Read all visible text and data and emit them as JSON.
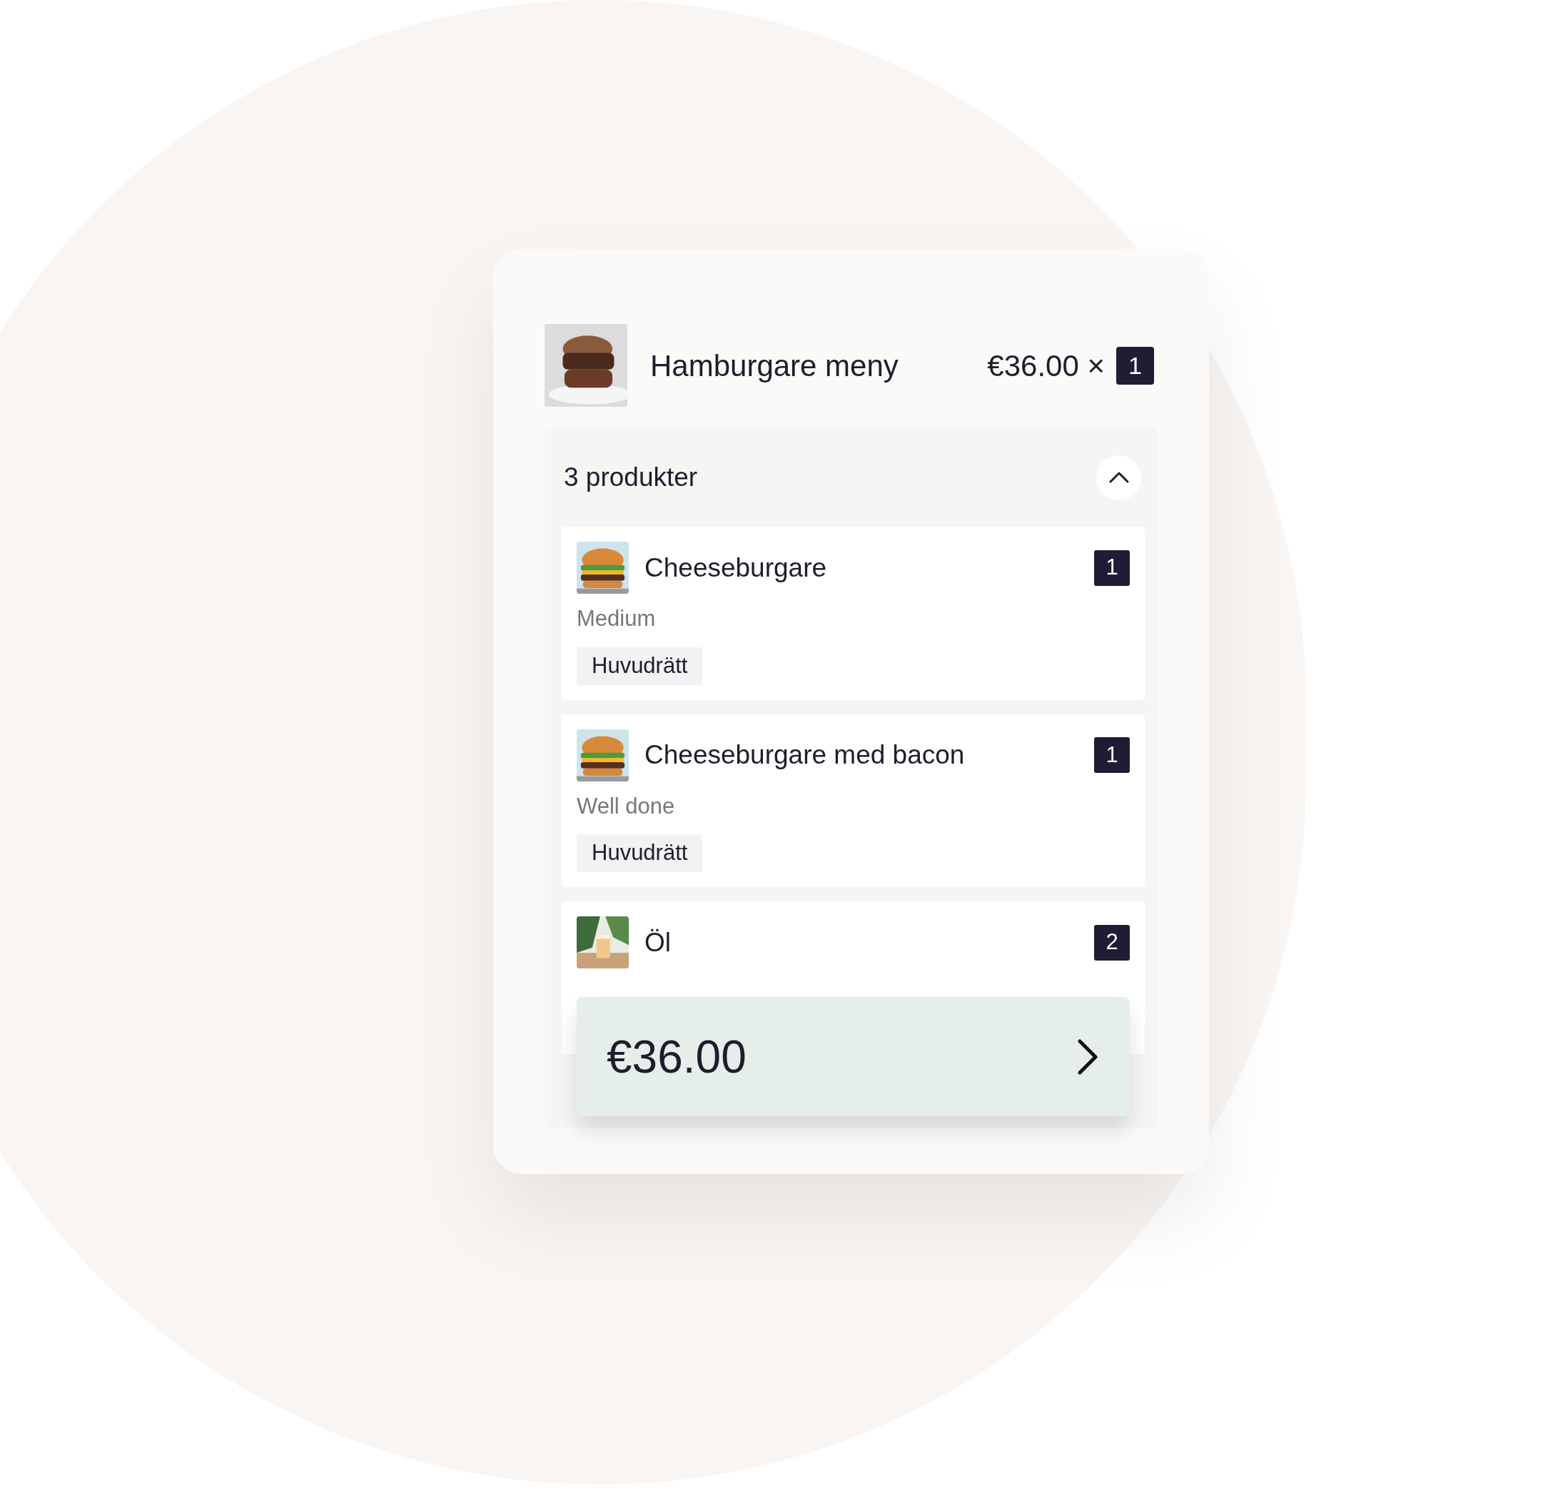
{
  "order": {
    "title": "Hamburgare meny",
    "price": "€36.00 ×",
    "quantity": "1"
  },
  "products": {
    "summary": "3 produkter",
    "expanded": true,
    "items": [
      {
        "name": "Cheeseburgare",
        "quantity": "1",
        "option": "Medium",
        "tag": "Huvudrätt",
        "kind": "burger"
      },
      {
        "name": "Cheeseburgare med bacon",
        "quantity": "1",
        "option": "Well done",
        "tag": "Huvudrätt",
        "kind": "burger"
      },
      {
        "name": "Öl",
        "quantity": "2",
        "kind": "drink"
      }
    ]
  },
  "total": {
    "amount": "€36.00"
  }
}
